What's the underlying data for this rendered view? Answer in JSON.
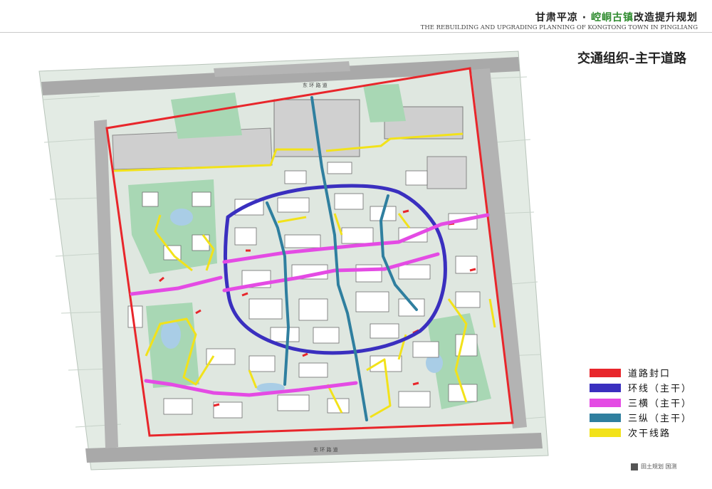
{
  "header": {
    "title_prefix": "甘肃平凉 · ",
    "title_highlight": "崆峒古镇",
    "title_suffix": "改造提升规划",
    "subtitle": "THE REBUILDING AND UPGRADING PLANNING OF KONGTONG  TOWN IN PINGLIANG"
  },
  "section_title": "交通组织–主干道路",
  "map": {
    "road_label_top": "东 环 路 道",
    "road_label_bottom": "东 环 路 道"
  },
  "legend": [
    {
      "label": "道路封口",
      "color": "#e8262b"
    },
    {
      "label": "环线（主干）",
      "color": "#3a2fbf"
    },
    {
      "label": "三横（主干）",
      "color": "#e44be4"
    },
    {
      "label": "三纵（主干）",
      "color": "#2f7f9f"
    },
    {
      "label": "次干线路",
      "color": "#f2e21a"
    }
  ],
  "footer": {
    "brand": "田土规划 国测"
  }
}
